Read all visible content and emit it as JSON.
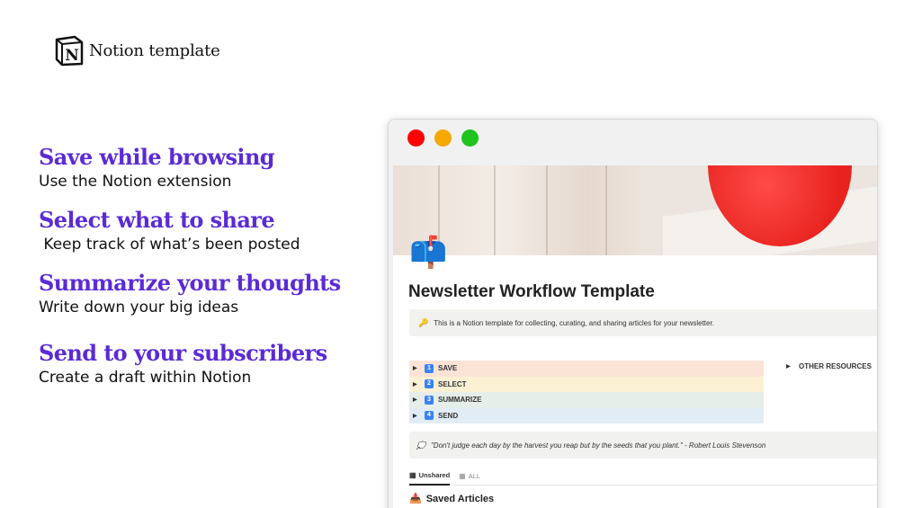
{
  "brand": {
    "text": "Notion template",
    "logo_icon": "notion-logo-icon"
  },
  "features": [
    {
      "title": "Save while browsing",
      "desc": "Use the Notion extension"
    },
    {
      "title": "Select what to share",
      "desc": " Keep track of what’s been posted"
    },
    {
      "title": "Summarize your thoughts",
      "desc": "Write down your big ideas"
    },
    {
      "title": "Send to your subscribers",
      "desc": "Create a draft within Notion"
    }
  ],
  "window": {
    "dots": {
      "close": "#ff0000",
      "minimize": "#f5a800",
      "zoom": "#1fc41f"
    },
    "page_icon": "📫",
    "title": "Newsletter Workflow Template",
    "callout": {
      "icon": "🔑",
      "text": "This is a Notion template for collecting, curating, and sharing articles for your newsletter."
    },
    "steps": [
      {
        "num": "1",
        "label": "SAVE",
        "color": "#fbe4d6"
      },
      {
        "num": "2",
        "label": "SELECT",
        "color": "#fbf0d4"
      },
      {
        "num": "3",
        "label": "SUMMARIZE",
        "color": "#e5eee8"
      },
      {
        "num": "4",
        "label": "SEND",
        "color": "#e2ecf5"
      }
    ],
    "other_resources": "OTHER RESOURCES",
    "quote": {
      "icon": "💭",
      "text": "\"Don't judge each day by the harvest you reap but by the seeds that you plant.\" - Robert Louis Stevenson"
    },
    "tabs": [
      {
        "label": "Unshared",
        "active": true
      },
      {
        "label": "ALL",
        "active": false
      }
    ],
    "section": {
      "icon": "📥",
      "title": "Saved Articles"
    }
  }
}
